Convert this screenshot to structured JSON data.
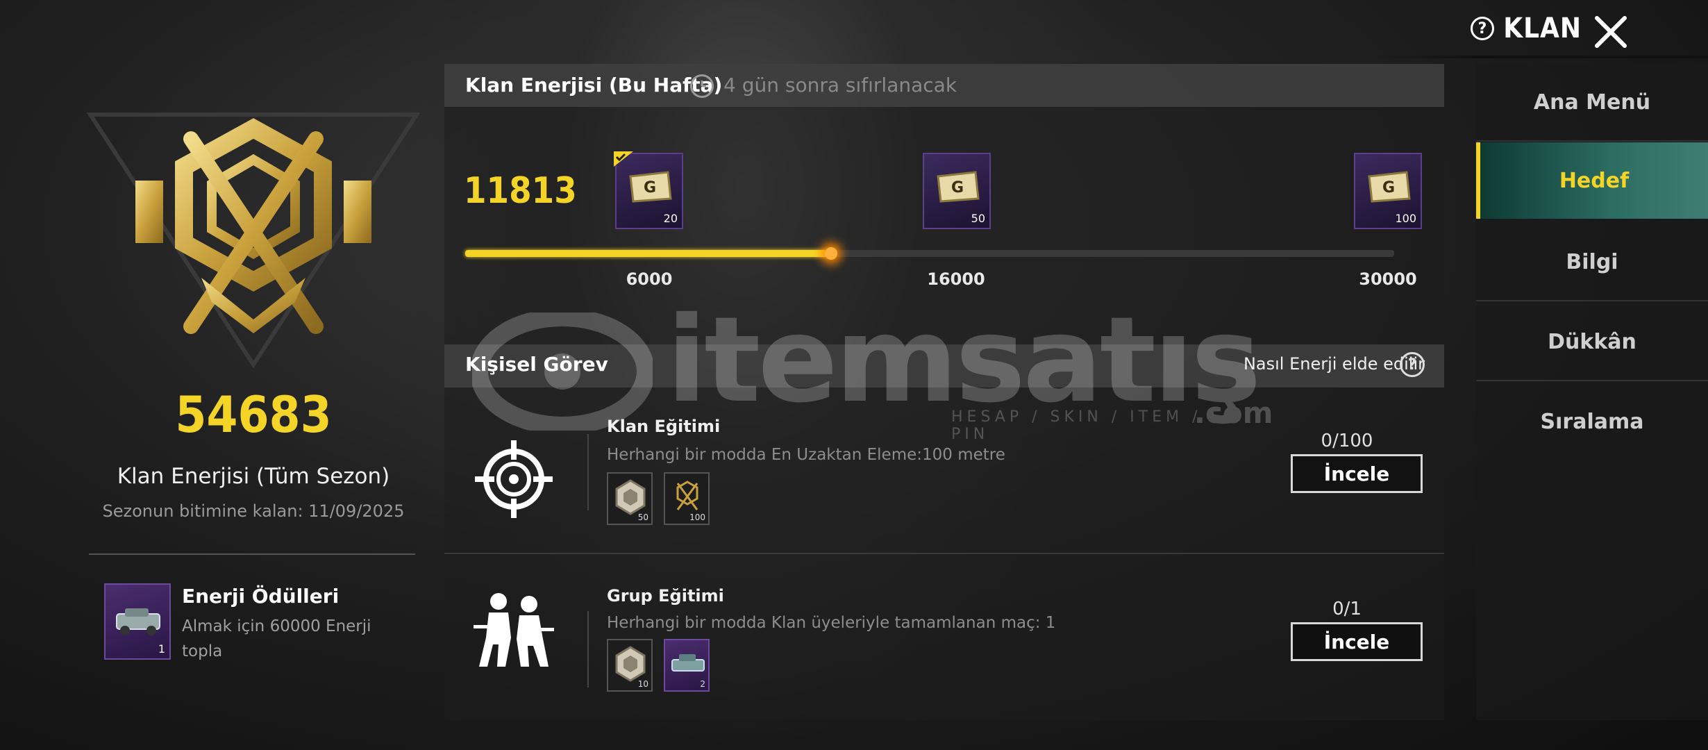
{
  "header": {
    "title": "KLAN",
    "help_icon": "question-circle-icon",
    "close_icon": "close-icon"
  },
  "left": {
    "season_energy": "54683",
    "season_energy_label": "Klan Enerjisi (Tüm Sezon)",
    "season_end": "Sezonun bitimine kalan: 11/09/2025",
    "reward_title": "Enerji Ödülleri",
    "reward_desc": "Almak için 60000 Enerji topla",
    "reward_count": "1"
  },
  "weekly": {
    "title": "Klan Enerjisi (Bu Hafta)",
    "reset_text": "4 gün sonra sıfırlanacak",
    "current": "11813",
    "progress_fraction": 0.394,
    "milestones": [
      {
        "threshold": "6000",
        "reward_count": "20",
        "claimed": true
      },
      {
        "threshold": "16000",
        "reward_count": "50",
        "claimed": false
      },
      {
        "threshold": "30000",
        "reward_count": "100",
        "claimed": false
      }
    ]
  },
  "personal": {
    "title": "Kişisel Görev",
    "how_to": "Nasıl Enerji elde edilir",
    "tasks": [
      {
        "title": "Klan Eğitimi",
        "desc": "Herhangi bir modda En Uzaktan Eleme:100 metre",
        "progress": "0/100",
        "button": "İncele",
        "icon": "crosshair-icon",
        "rewards": [
          {
            "count": "50",
            "icon": "badge-icon"
          },
          {
            "count": "100",
            "icon": "clan-emblem-icon"
          }
        ]
      },
      {
        "title": "Grup Eğitimi",
        "desc": "Herhangi bir modda Klan üyeleriyle tamamlanan maç: 1",
        "progress": "0/1",
        "button": "İncele",
        "icon": "squad-icon",
        "rewards": [
          {
            "count": "10",
            "icon": "badge-icon"
          },
          {
            "count": "2",
            "icon": "vehicle-icon"
          }
        ]
      }
    ]
  },
  "nav": {
    "items": [
      "Ana Menü",
      "Hedef",
      "Bilgi",
      "Dükkân",
      "Sıralama"
    ],
    "active": "Hedef"
  },
  "watermark": {
    "main": "itemsatış",
    "sub": "HESAP / SKIN / ITEM / E-PIN",
    "com": ".com"
  },
  "colors": {
    "accent": "#f5d428",
    "active_nav": "#2d6e63",
    "chest_purple": "#3c2a5e"
  }
}
